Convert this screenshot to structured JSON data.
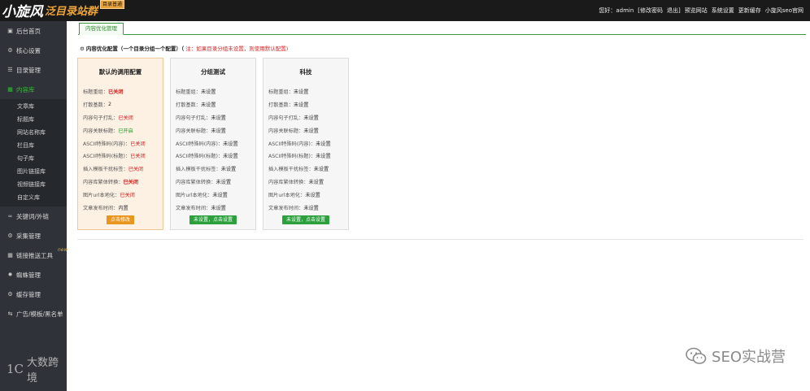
{
  "header": {
    "logo_main": "小旋风",
    "logo_sub": "泛目录站群",
    "logo_badge": "目录普通",
    "welcome": "您好：admin",
    "change_password": "[修改密码",
    "logout": "退出]",
    "preview_site": "预览网站",
    "system_settings": "系统设置",
    "update_cache": "更新缓存",
    "official_site": "小旋风seo官网"
  },
  "sidebar": {
    "items": [
      {
        "label": "后台首页",
        "icon": "monitor-icon"
      },
      {
        "label": "核心设置",
        "icon": "gear-icon"
      },
      {
        "label": "目录管理",
        "icon": "list-icon"
      },
      {
        "label": "内容库",
        "icon": "book-icon",
        "active": true
      },
      {
        "label": "关键词/外链",
        "icon": "link-icon"
      },
      {
        "label": "采集管理",
        "icon": "gear-icon"
      },
      {
        "label": "链接推送工具",
        "icon": "grid-icon",
        "badge": "new"
      },
      {
        "label": "蜘蛛管理",
        "icon": "spider-icon"
      },
      {
        "label": "缓存管理",
        "icon": "gear-icon"
      },
      {
        "label": "广告/模板/黑名单",
        "icon": "arrows-icon"
      }
    ],
    "sub_items": [
      "文章库",
      "标题库",
      "网站名称库",
      "栏目库",
      "句子库",
      "图片链接库",
      "视频链接库",
      "自定义库"
    ]
  },
  "main": {
    "tab_label": "内容优化管理",
    "section_title": "内容优化配置（一个目录分组一个配置）（",
    "section_note": "注：如果目录分组未设置，则使用默认配置)",
    "cards": [
      {
        "title": "默认的调用配置",
        "rows": [
          {
            "label": "标题重组：",
            "value": "已关闭",
            "style": "red-b"
          },
          {
            "label": "打散基数：",
            "value": "2",
            "style": "dark"
          },
          {
            "label": "内容句子打乱：",
            "value": "已关闭",
            "style": "red"
          },
          {
            "label": "内容关联标题：",
            "value": "已开启",
            "style": "green"
          },
          {
            "label": "ASCII特殊码(内容)：",
            "value": "已关闭",
            "style": "red"
          },
          {
            "label": "ASCII特殊码(标题)：",
            "value": "已关闭",
            "style": "red"
          },
          {
            "label": "插入模板干扰标签：",
            "value": "已关闭",
            "style": "red"
          },
          {
            "label": "内容库繁体转换：",
            "value": "已关闭",
            "style": "red-b"
          },
          {
            "label": "图片url本地化：",
            "value": "已关闭",
            "style": "red"
          },
          {
            "label": "文章发布时间：",
            "value": "内置",
            "style": "dark"
          }
        ],
        "button": "点击修改"
      },
      {
        "title": "分组测试",
        "rows": [
          {
            "label": "标题重组：",
            "value": "未设置",
            "style": "dark"
          },
          {
            "label": "打散基数：",
            "value": "未设置",
            "style": "dark"
          },
          {
            "label": "内容句子打乱：",
            "value": "未设置",
            "style": "dark"
          },
          {
            "label": "内容关联标题：",
            "value": "未设置",
            "style": "dark"
          },
          {
            "label": "ASCII特殊码(内容)：",
            "value": "未设置",
            "style": "dark"
          },
          {
            "label": "ASCII特殊码(标题)：",
            "value": "未设置",
            "style": "dark"
          },
          {
            "label": "插入模板干扰标签：",
            "value": "未设置",
            "style": "dark"
          },
          {
            "label": "内容库繁体转换：",
            "value": "未设置",
            "style": "dark"
          },
          {
            "label": "图片url本地化：",
            "value": "未设置",
            "style": "dark"
          },
          {
            "label": "文章发布时间：",
            "value": "未设置",
            "style": "dark"
          }
        ],
        "button": "未设置，点击设置"
      },
      {
        "title": "科技",
        "rows": [
          {
            "label": "标题重组：",
            "value": "未设置",
            "style": "dark"
          },
          {
            "label": "打散基数：",
            "value": "未设置",
            "style": "dark"
          },
          {
            "label": "内容句子打乱：",
            "value": "未设置",
            "style": "dark"
          },
          {
            "label": "内容关联标题：",
            "value": "未设置",
            "style": "dark"
          },
          {
            "label": "ASCII特殊码(内容)：",
            "value": "未设置",
            "style": "dark"
          },
          {
            "label": "ASCII特殊码(标题)：",
            "value": "未设置",
            "style": "dark"
          },
          {
            "label": "插入模板干扰标签：",
            "value": "未设置",
            "style": "dark"
          },
          {
            "label": "内容库繁体转换：",
            "value": "未设置",
            "style": "dark"
          },
          {
            "label": "图片url本地化：",
            "value": "未设置",
            "style": "dark"
          },
          {
            "label": "文章发布时间：",
            "value": "未设置",
            "style": "dark"
          }
        ],
        "button": "未设置，点击设置"
      }
    ]
  },
  "watermarks": {
    "left_num": "1C",
    "left_text": "大数跨境",
    "right_text": "SEO实战营"
  },
  "colors": {
    "header_bg": "#1a1a1a",
    "sidebar_bg": "#2f3238",
    "active_green": "#2fbf2f",
    "accent_orange": "#e9961e",
    "button_green": "#2ca03c",
    "status_red": "#d21f1f"
  }
}
